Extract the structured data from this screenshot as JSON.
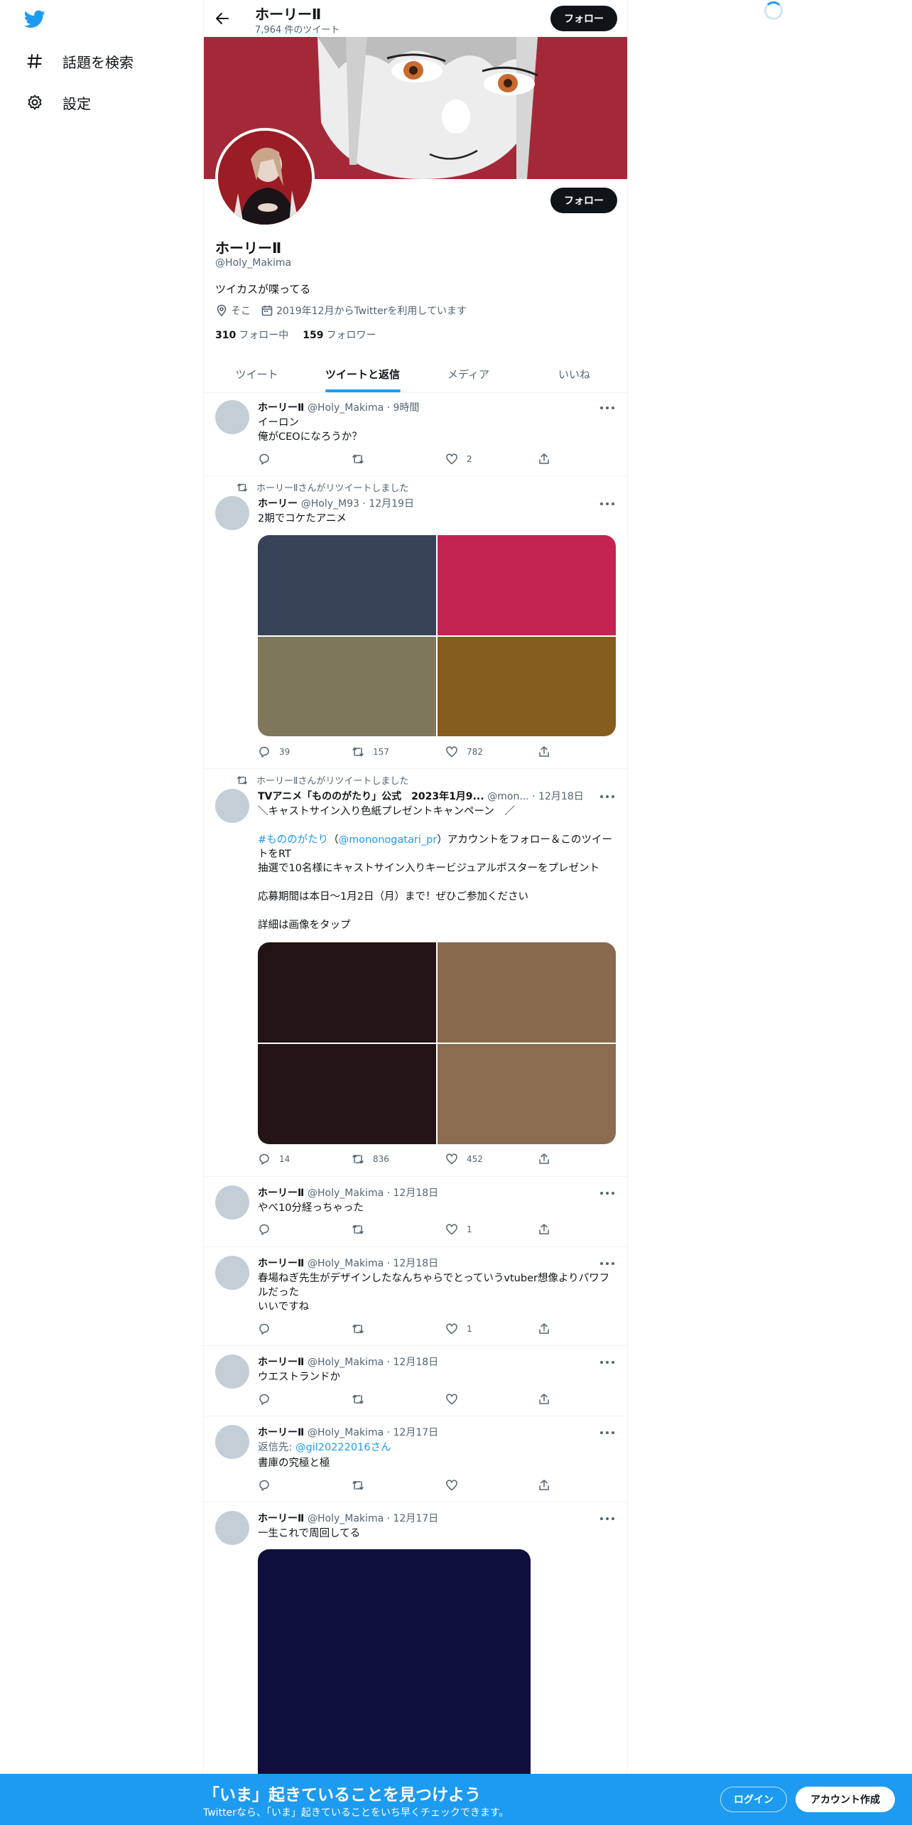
{
  "nav": {
    "logo": "twitter-bird-icon",
    "items": [
      {
        "label": "話題を検索",
        "icon": "hashtag-icon"
      },
      {
        "label": "設定",
        "icon": "gear-icon"
      }
    ]
  },
  "header": {
    "name": "ホーリーⅡ",
    "tweet_count": "7,964 件のツイート",
    "follow_label": "フォロー"
  },
  "profile": {
    "name": "ホーリーⅡ",
    "handle": "@Holy_Makima",
    "bio": "ツイカスが喋ってる",
    "location": "そこ",
    "joined": "2019年12月からTwitterを利用しています",
    "following_count": "310",
    "following_label": "フォロー中",
    "followers_count": "159",
    "followers_label": "フォロワー",
    "follow_label": "フォロー"
  },
  "tabs": [
    {
      "label": "ツイート",
      "active": false
    },
    {
      "label": "ツイートと返信",
      "active": true
    },
    {
      "label": "メディア",
      "active": false
    },
    {
      "label": "いいね",
      "active": false
    }
  ],
  "tweets": [
    {
      "name": "ホーリーⅡ",
      "handle": "@Holy_Makima",
      "time": "9時間",
      "text": "イーロン\n俺がCEOになろうか？",
      "reply": "",
      "retweet": "",
      "like": "2"
    },
    {
      "retweeted_by": "ホーリーⅡさんがリツイートしました",
      "name": "ホーリー",
      "handle": "@Holy_M93",
      "time": "12月19日",
      "text": "2期でコケたアニメ",
      "reply": "39",
      "retweet": "157",
      "like": "782",
      "media_colors": [
        "#364257",
        "#c42452",
        "#7d775c",
        "#855d1c"
      ]
    },
    {
      "retweeted_by": "ホーリーⅡさんがリツイートしました",
      "name": "TVアニメ「もののがたり」公式　2023年1月9...",
      "handle": "@mon...",
      "time": "12月18日",
      "text_1": "＼キャストサイン入り色紙プレゼントキャンペーン　／",
      "hashtag": "#もののがたり",
      "mention": "@mononogatari_pr",
      "text_2": "アカウントをフォロー＆このツイートをRT",
      "text_3": "抽選で10名様にキャストサイン入りキービジュアルポスターをプレゼント",
      "text_4": "応募期間は本日〜1月2日（月）まで！ぜひご参加ください",
      "text_5": "詳細は画像をタップ",
      "reply": "14",
      "retweet": "836",
      "like": "452",
      "media_colors": [
        "#231414",
        "#8a6a4e",
        "#241414",
        "#8b6c51"
      ]
    },
    {
      "name": "ホーリーⅡ",
      "handle": "@Holy_Makima",
      "time": "12月18日",
      "text": "やべ10分経っちゃった",
      "reply": "",
      "retweet": "",
      "like": "1"
    },
    {
      "name": "ホーリーⅡ",
      "handle": "@Holy_Makima",
      "time": "12月18日",
      "text": "春場ねぎ先生がデザインしたなんちゃらでとっていうvtuber想像よりパワフルだった\nいいですね",
      "reply": "",
      "retweet": "",
      "like": "1"
    },
    {
      "name": "ホーリーⅡ",
      "handle": "@Holy_Makima",
      "time": "12月18日",
      "text": "ウエストランドか",
      "reply": "",
      "retweet": "",
      "like": ""
    },
    {
      "name": "ホーリーⅡ",
      "handle": "@Holy_Makima",
      "time": "12月17日",
      "reply_to_prefix": "返信先: ",
      "reply_to": "@gil20222016",
      "reply_to_suffix": "さん",
      "text": "書庫の究極と極",
      "reply": "",
      "retweet": "",
      "like": ""
    },
    {
      "name": "ホーリーⅡ",
      "handle": "@Holy_Makima",
      "time": "12月17日",
      "text": "一生これで周回してる",
      "media_colors": [
        "#0f0f3e"
      ]
    }
  ],
  "bottom_bar": {
    "title": "「いま」起きていることを見つけよう",
    "subtitle": "Twitterなら、「いま」起きていることをいち早くチェックできます。",
    "login": "ログイン",
    "signup": "アカウント作成"
  },
  "colors": {
    "accent": "#1d9bf0",
    "banner": "#a42938",
    "text": "#0f1419",
    "muted": "#536471"
  }
}
